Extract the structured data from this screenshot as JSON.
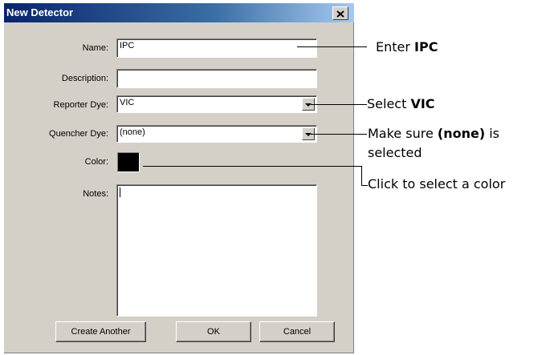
{
  "dialog": {
    "title": "New Detector",
    "close_glyph": "✕"
  },
  "form": {
    "name_label": "Name:",
    "name_value": "IPC",
    "description_label": "Description:",
    "description_value": "",
    "reporter_label": "Reporter Dye:",
    "reporter_value": "VIC",
    "quencher_label": "Quencher Dye:",
    "quencher_value": "(none)",
    "color_label": "Color:",
    "color_value": "#000000",
    "notes_label": "Notes:",
    "notes_value": ""
  },
  "buttons": {
    "create_another": "Create Another",
    "ok": "OK",
    "cancel": "Cancel"
  },
  "callouts": {
    "name": {
      "prefix": "Enter ",
      "bold": "IPC",
      "suffix": ""
    },
    "reporter": {
      "prefix": "Select ",
      "bold": "VIC",
      "suffix": ""
    },
    "quencher": {
      "prefix": "Make sure ",
      "bold": "(none)",
      "suffix": " is",
      "line2": "selected"
    },
    "color": {
      "text": "Click to select a color"
    }
  },
  "icons": {
    "close": "close-icon",
    "dropdown": "chevron-down-icon"
  }
}
